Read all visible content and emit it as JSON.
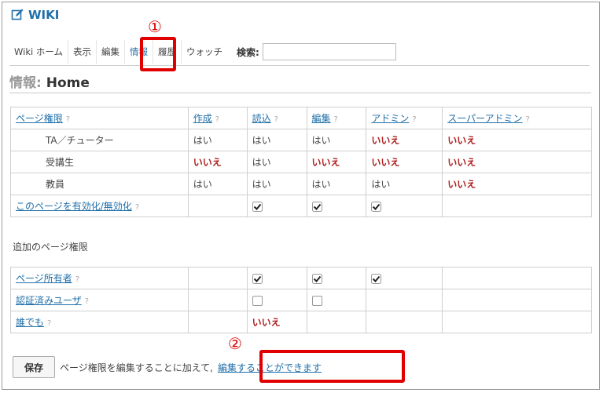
{
  "header": {
    "title": "WIKI",
    "icon": "edit-icon"
  },
  "markers": {
    "one": "①",
    "two": "②"
  },
  "tabs": [
    {
      "label": "Wiki ホーム"
    },
    {
      "label": "表示"
    },
    {
      "label": "編集"
    },
    {
      "label": "情報"
    },
    {
      "label": "履歴"
    },
    {
      "label": "ウォッチ"
    }
  ],
  "search": {
    "label": "検索:",
    "value": "",
    "placeholder": ""
  },
  "page_title": {
    "prefix": "情報:",
    "name": "Home"
  },
  "permissions_table": {
    "header": [
      "ページ権限",
      "作成",
      "読込",
      "編集",
      "アドミン",
      "スーパーアドミン"
    ],
    "help": "?",
    "rows": [
      {
        "role": "TA／チューター",
        "values": [
          "はい",
          "はい",
          "はい",
          "いいえ",
          "いいえ"
        ]
      },
      {
        "role": "受講生",
        "values": [
          "いいえ",
          "はい",
          "いいえ",
          "いいえ",
          "いいえ"
        ]
      },
      {
        "role": "教員",
        "values": [
          "はい",
          "はい",
          "はい",
          "はい",
          "いいえ"
        ]
      }
    ],
    "enable_row": {
      "label": "このページを有効化/無効化",
      "checks": [
        "",
        "checked",
        "checked",
        "checked",
        ""
      ]
    }
  },
  "additional": {
    "section_label": "追加のページ権限",
    "rows": [
      {
        "label": "ページ所有者",
        "cells": [
          "",
          "checked",
          "checked",
          "checked",
          ""
        ]
      },
      {
        "label": "認証済みユーザ",
        "cells": [
          "",
          "unchecked",
          "unchecked",
          "",
          ""
        ]
      },
      {
        "label": "誰でも",
        "cells": [
          "",
          "いいえ",
          "",
          "",
          ""
        ]
      }
    ]
  },
  "footer": {
    "save_label": "保存",
    "description": "ページ権限を編集することに加えて,",
    "link": "編集することができます"
  },
  "colors": {
    "accent": "#1f6fa8",
    "highlight": "#e00000",
    "no": "#b02020"
  }
}
